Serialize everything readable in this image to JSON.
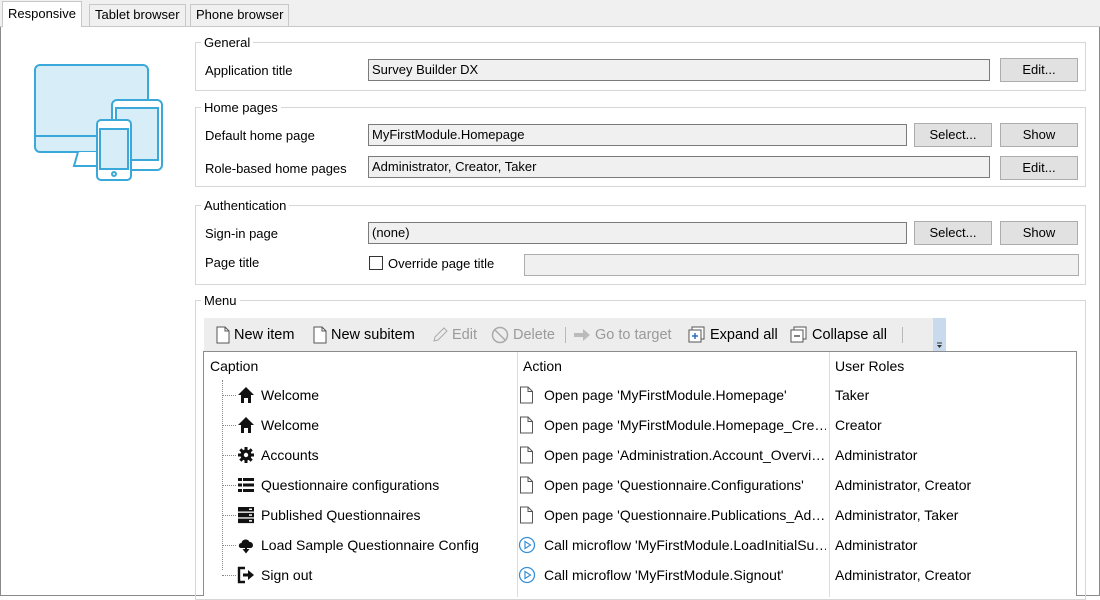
{
  "tabs": [
    {
      "label": "Responsive",
      "active": true
    },
    {
      "label": "Tablet browser",
      "active": false
    },
    {
      "label": "Phone browser",
      "active": false
    }
  ],
  "general": {
    "title": "General",
    "app_title_label": "Application title",
    "app_title_value": "Survey Builder DX",
    "edit_label": "Edit..."
  },
  "home_pages": {
    "title": "Home pages",
    "default_label": "Default home page",
    "default_value": "MyFirstModule.Homepage",
    "select_label": "Select...",
    "show_label": "Show",
    "role_label": "Role-based home pages",
    "role_value": "Administrator, Creator, Taker",
    "edit_label": "Edit..."
  },
  "authentication": {
    "title": "Authentication",
    "signin_label": "Sign-in page",
    "signin_value": "(none)",
    "select_label": "Select...",
    "show_label": "Show",
    "page_title_label": "Page title",
    "override_label": "Override page title",
    "override_checked": false,
    "page_title_value": ""
  },
  "menu": {
    "title": "Menu",
    "toolbar": {
      "new_item": "New item",
      "new_subitem": "New subitem",
      "edit": "Edit",
      "delete": "Delete",
      "go_to_target": "Go to target",
      "expand_all": "Expand all",
      "collapse_all": "Collapse all"
    },
    "columns": {
      "caption": "Caption",
      "action": "Action",
      "user_roles": "User Roles"
    },
    "rows": [
      {
        "caption": "Welcome",
        "icon": "home-icon",
        "action": "Open page 'MyFirstModule.Homepage'",
        "action_icon": "page-icon",
        "roles": "Taker"
      },
      {
        "caption": "Welcome",
        "icon": "home-icon",
        "action": "Open page 'MyFirstModule.Homepage_Cre…",
        "action_icon": "page-icon",
        "roles": "Creator"
      },
      {
        "caption": "Accounts",
        "icon": "gear-icon",
        "action": "Open page 'Administration.Account_Overvi…",
        "action_icon": "page-icon",
        "roles": "Administrator"
      },
      {
        "caption": "Questionnaire configurations",
        "icon": "list-icon",
        "action": "Open page 'Questionnaire.Configurations'",
        "action_icon": "page-icon",
        "roles": "Administrator, Creator"
      },
      {
        "caption": "Published Questionnaires",
        "icon": "server-icon",
        "action": "Open page 'Questionnaire.Publications_Ad…",
        "action_icon": "page-icon",
        "roles": "Administrator, Taker"
      },
      {
        "caption": "Load Sample Questionnaire Config",
        "icon": "cloud-download-icon",
        "action": "Call  microflow 'MyFirstModule.LoadInitialSu…",
        "action_icon": "microflow-icon",
        "roles": "Administrator"
      },
      {
        "caption": "Sign out",
        "icon": "sign-out-icon",
        "action": "Call microflow 'MyFirstModule.Signout'",
        "action_icon": "microflow-icon",
        "roles": "Administrator, Creator"
      }
    ]
  },
  "colors": {
    "accent": "#3aa8d8",
    "toolbar_bg": "#ededed",
    "gripper": "#c9d9ee"
  }
}
